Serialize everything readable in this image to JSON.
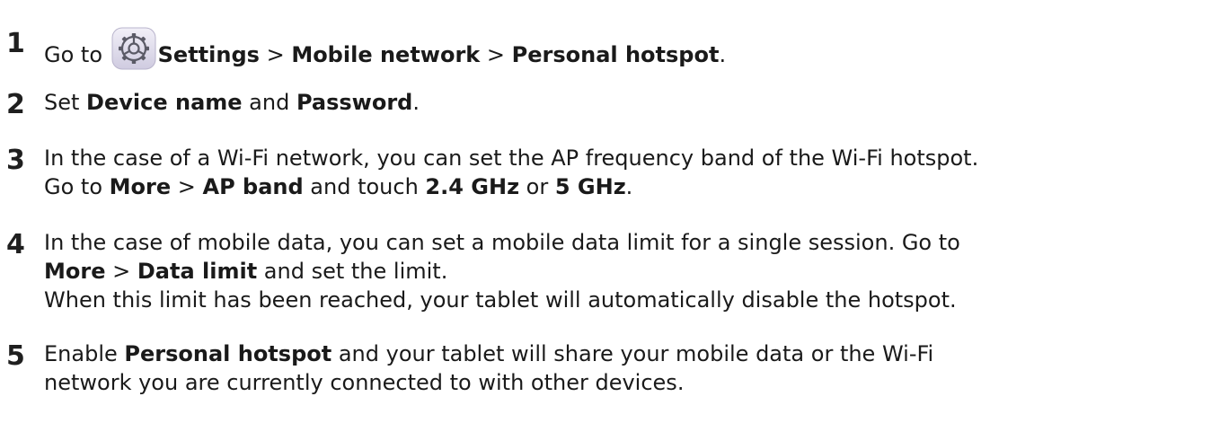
{
  "steps": [
    {
      "number": "1",
      "lines": [
        {
          "segments": [
            {
              "t": "Go to ",
              "b": false
            },
            {
              "icon": "settings-gear-icon"
            },
            {
              "t": "Settings",
              "b": true
            },
            {
              "t": " > ",
              "b": false
            },
            {
              "t": "Mobile network",
              "b": true
            },
            {
              "t": " > ",
              "b": false
            },
            {
              "t": "Personal hotspot",
              "b": true
            },
            {
              "t": ".",
              "b": false
            }
          ]
        }
      ]
    },
    {
      "number": "2",
      "lines": [
        {
          "segments": [
            {
              "t": "Set ",
              "b": false
            },
            {
              "t": "Device name",
              "b": true
            },
            {
              "t": " and ",
              "b": false
            },
            {
              "t": "Password",
              "b": true
            },
            {
              "t": ".",
              "b": false
            }
          ]
        }
      ]
    },
    {
      "number": "3",
      "lines": [
        {
          "segments": [
            {
              "t": "In the case of a Wi-Fi network, you can set the AP frequency band of the Wi-Fi hotspot.",
              "b": false
            }
          ]
        },
        {
          "segments": [
            {
              "t": "Go to ",
              "b": false
            },
            {
              "t": "More",
              "b": true
            },
            {
              "t": " > ",
              "b": false
            },
            {
              "t": "AP band",
              "b": true
            },
            {
              "t": " and touch ",
              "b": false
            },
            {
              "t": "2.4 GHz",
              "b": true
            },
            {
              "t": " or ",
              "b": false
            },
            {
              "t": "5 GHz",
              "b": true
            },
            {
              "t": ".",
              "b": false
            }
          ]
        }
      ]
    },
    {
      "number": "4",
      "lines": [
        {
          "segments": [
            {
              "t": "In the case of mobile data, you can set a mobile data limit for a single session. Go to",
              "b": false
            }
          ]
        },
        {
          "segments": [
            {
              "t": "More",
              "b": true
            },
            {
              "t": " > ",
              "b": false
            },
            {
              "t": "Data limit",
              "b": true
            },
            {
              "t": " and set the limit.",
              "b": false
            }
          ]
        },
        {
          "segments": [
            {
              "t": "When this limit has been reached, your tablet will automatically disable the hotspot.",
              "b": false
            }
          ]
        }
      ]
    },
    {
      "number": "5",
      "lines": [
        {
          "segments": [
            {
              "t": "Enable ",
              "b": false
            },
            {
              "t": "Personal hotspot",
              "b": true
            },
            {
              "t": " and your tablet will share your mobile data or the Wi-Fi",
              "b": false
            }
          ]
        },
        {
          "segments": [
            {
              "t": "network you are currently connected to with other devices.",
              "b": false
            }
          ]
        }
      ]
    }
  ],
  "colors": {
    "text": "#1a1a1a",
    "icon_bg_top": "#f2f0f8",
    "icon_bg_bottom": "#cfcbe0",
    "icon_gear": "#5a5a66"
  }
}
